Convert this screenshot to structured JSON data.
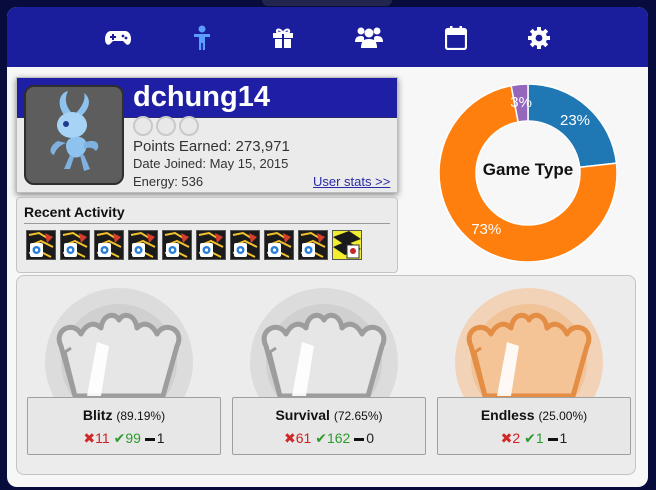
{
  "nav": {
    "items": [
      {
        "icon": "gamepad-icon",
        "active": false
      },
      {
        "icon": "person-icon",
        "active": true
      },
      {
        "icon": "gift-icon",
        "active": false
      },
      {
        "icon": "group-icon",
        "active": false
      },
      {
        "icon": "calendar-icon",
        "active": false
      },
      {
        "icon": "gear-icon",
        "active": false
      }
    ],
    "colors": {
      "bar": "#1a1d9c",
      "icon": "#ffffff",
      "active_icon": "#5b9cff"
    }
  },
  "profile": {
    "username": "dchung14",
    "points_label": "Points Earned: 273,971",
    "joined_label": "Date Joined: May 15, 2015",
    "energy_label": "Energy: 536",
    "stats_link": "User stats >>",
    "avatar": "creature-avatar-icon"
  },
  "recent_activity": {
    "title": "Recent Activity",
    "thumbnails": [
      "game-thumbnail-icon",
      "game-thumbnail-icon",
      "game-thumbnail-icon",
      "game-thumbnail-icon",
      "game-thumbnail-icon",
      "game-thumbnail-icon",
      "game-thumbnail-icon",
      "game-thumbnail-icon",
      "game-thumbnail-icon",
      "game-thumbnail-alt-icon"
    ]
  },
  "chart_data": {
    "type": "pie",
    "title": "Game Type",
    "slices": [
      {
        "label": "23%",
        "value": 23,
        "color": "#1f77b4"
      },
      {
        "label": "73%",
        "value": 73,
        "color": "#ff7f0e"
      },
      {
        "label": "3%",
        "value": 3,
        "color": "#9467bd"
      }
    ]
  },
  "modes": [
    {
      "name": "Blitz",
      "percent": "(89.19%)",
      "losses": "11",
      "wins": "99",
      "draws": "1",
      "medal": "silver-crown-medal-icon"
    },
    {
      "name": "Survival",
      "percent": "(72.65%)",
      "losses": "61",
      "wins": "162",
      "draws": "0",
      "medal": "silver-crown-medal-icon"
    },
    {
      "name": "Endless",
      "percent": "(25.00%)",
      "losses": "2",
      "wins": "1",
      "draws": "1",
      "medal": "bronze-crown-medal-icon"
    }
  ]
}
